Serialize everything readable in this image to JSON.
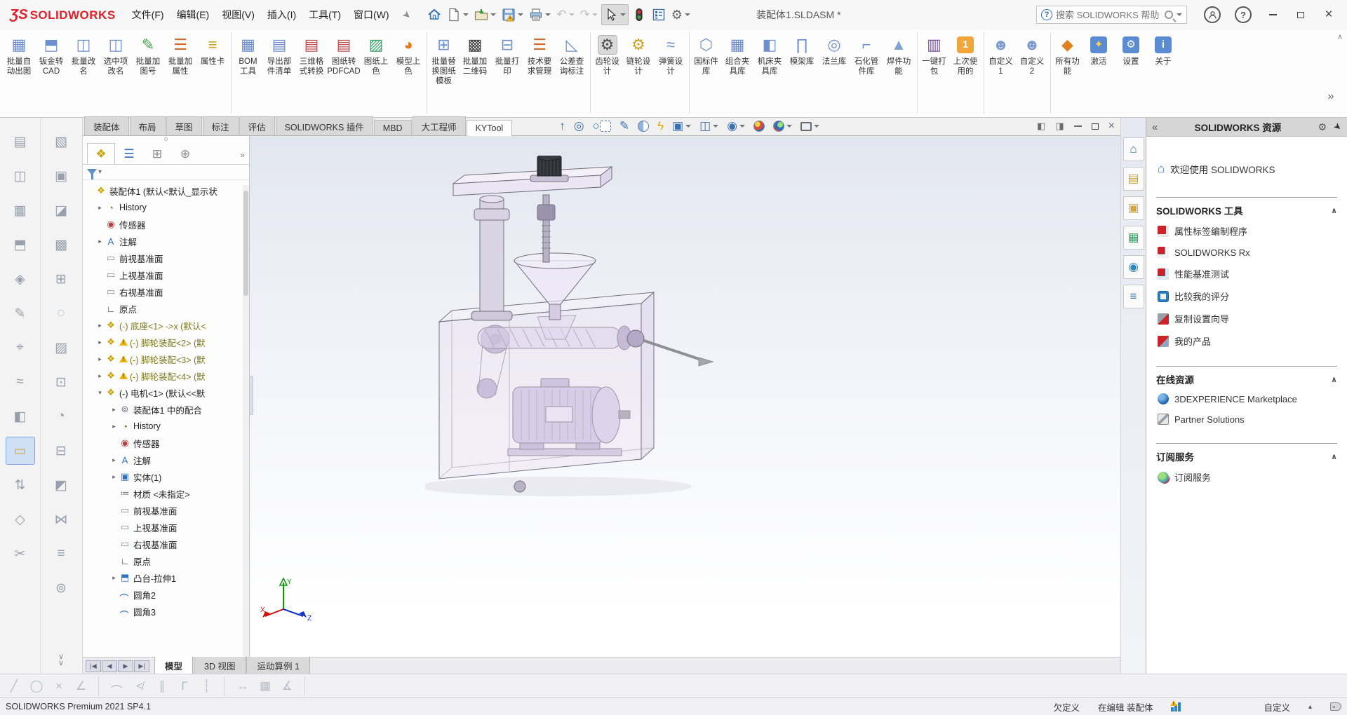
{
  "titlebar": {
    "brand_mark": "ƷS",
    "brand": "SOLIDWORKS",
    "menus": [
      "文件(F)",
      "编辑(E)",
      "视图(V)",
      "插入(I)",
      "工具(T)",
      "窗口(W)"
    ],
    "doc_title": "装配体1.SLDASM *",
    "search": {
      "placeholder": "搜索 SOLIDWORKS 帮助",
      "help_glyph": "?"
    },
    "help_glyph": "?",
    "close_glyph": "×"
  },
  "ribbon": {
    "overflow_glyph": "»",
    "collapse_glyph": "∧",
    "buttons": [
      {
        "l": "批量自\n动出图",
        "g": "▦",
        "c": "#6c8fd0"
      },
      {
        "l": "钣金转\nCAD",
        "g": "⬒",
        "c": "#6c8fd0"
      },
      {
        "l": "批量改\n名",
        "g": "◫",
        "c": "#6c8fd0"
      },
      {
        "l": "选中项\n改名",
        "g": "◫",
        "c": "#6c8fd0"
      },
      {
        "l": "批量加\n图号",
        "g": "✎",
        "c": "#49a04e"
      },
      {
        "l": "批量加\n属性",
        "g": "☰",
        "c": "#d06a2c"
      },
      {
        "l": "属性卡",
        "g": "≡",
        "c": "#c9a227"
      },
      {
        "l": "BOM\n工具",
        "g": "▦",
        "c": "#6c8fd0",
        "cls": "gs"
      },
      {
        "l": "导出部\n件清单",
        "g": "▤",
        "c": "#6c8fd0"
      },
      {
        "l": "三维格\n式转换",
        "g": "▤",
        "c": "#c0504d"
      },
      {
        "l": "图纸转\nPDFCAD",
        "g": "▤",
        "c": "#c0504d"
      },
      {
        "l": "图纸上\n色",
        "g": "▨",
        "c": "#3aa06a"
      },
      {
        "l": "模型上\n色",
        "g": "◕",
        "c": "#e07820"
      },
      {
        "l": "批量替\n换图纸\n模板",
        "g": "⊞",
        "c": "#6c8fd0",
        "cls": "gs"
      },
      {
        "l": "批量加\n二维码",
        "g": "▩",
        "c": "#3c3c3c"
      },
      {
        "l": "批量打\n印",
        "g": "⊟",
        "c": "#6c8fd0"
      },
      {
        "l": "技术要\n求管理",
        "g": "☰",
        "c": "#d06a2c"
      },
      {
        "l": "公差查\n询标注",
        "g": "◺",
        "c": "#6c8fd0"
      },
      {
        "l": "齿轮设\n计",
        "g": "⚙",
        "c": "#4a4a50",
        "cls": "gs pressed"
      },
      {
        "l": "链轮设\n计",
        "g": "⚙",
        "c": "#c9a227"
      },
      {
        "l": "弹簧设\n计",
        "g": "≈",
        "c": "#6c8fd0"
      },
      {
        "l": "国标件\n库",
        "g": "⬡",
        "c": "#6c8fd0",
        "cls": "gs"
      },
      {
        "l": "组合夹\n具库",
        "g": "▦",
        "c": "#6c8fd0"
      },
      {
        "l": "机床夹\n具库",
        "g": "◧",
        "c": "#6c8fd0"
      },
      {
        "l": "模架库",
        "g": "∏",
        "c": "#6c8fd0"
      },
      {
        "l": "法兰库",
        "g": "◎",
        "c": "#6c8fd0"
      },
      {
        "l": "石化管\n件库",
        "g": "⌐",
        "c": "#6c8fd0"
      },
      {
        "l": "焊件功\n能",
        "g": "▲",
        "c": "#7fa3d6"
      },
      {
        "l": "一键打\n包",
        "g": "▥",
        "c": "#7a4fa0",
        "cls": "gs"
      },
      {
        "l": "上次使\n用的",
        "g": "1",
        "c": "#ffffff",
        "bg": "#f0a63a",
        "cls": "chip"
      },
      {
        "l": "自定义\n1",
        "g": "☻",
        "c": "#7d9bd0",
        "cls": "gs"
      },
      {
        "l": "自定义\n2",
        "g": "☻",
        "c": "#7d9bd0"
      },
      {
        "l": "所有功\n能",
        "g": "◆",
        "c": "#e08020",
        "cls": "gs"
      },
      {
        "l": "激活",
        "g": "✦",
        "c": "#ffd24a",
        "bg": "#5b8bd0",
        "cls": "chip"
      },
      {
        "l": "设置",
        "g": "⚙",
        "c": "#ffffff",
        "bg": "#5b8bd0",
        "cls": "chip"
      },
      {
        "l": "关于",
        "g": "i",
        "c": "#ffffff",
        "bg": "#5b8bd0",
        "cls": "chip"
      }
    ]
  },
  "cmdtabs": [
    {
      "l": "装配体"
    },
    {
      "l": "布局"
    },
    {
      "l": "草图"
    },
    {
      "l": "标注"
    },
    {
      "l": "评估"
    },
    {
      "l": "SOLIDWORKS 插件"
    },
    {
      "l": "MBD"
    },
    {
      "l": "大工程师"
    },
    {
      "l": "KYTool",
      "cls": "active"
    }
  ],
  "headsup": [
    {
      "name": "zoom-to-fit",
      "g": "↑",
      "c": "#3a6fae"
    },
    {
      "name": "zoom-to-area",
      "g": "◎",
      "c": "#3a6fae"
    },
    {
      "name": "zoom-area-window",
      "g": "○",
      "c": "#3a6fae",
      "art": "dashbox"
    },
    {
      "name": "previous-view",
      "g": "✎",
      "c": "#3a6fae"
    },
    {
      "name": "section-view",
      "art": "section"
    },
    {
      "name": "dynamic-annotation",
      "g": "ϟ",
      "c": "#e0a400"
    },
    {
      "name": "view-orientation",
      "g": "▣",
      "c": "#3a6fae",
      "dd": true
    },
    {
      "name": "display-style",
      "g": "◫",
      "c": "#3a6fae",
      "dd": true
    },
    {
      "name": "hide-show-items",
      "g": "◉",
      "c": "#3a6fae",
      "dd": true
    },
    {
      "name": "edit-appearance",
      "art": "ball1"
    },
    {
      "name": "apply-scene",
      "art": "ball2",
      "dd": true
    },
    {
      "name": "view-settings",
      "art": "screen",
      "dd": true
    }
  ],
  "winctl": {
    "pane_left": "◧",
    "pane_right": "◨",
    "close": "×"
  },
  "lefttools": {
    "more_glyph": "∨",
    "col1": [
      {
        "g": "▤"
      },
      {
        "g": "◫"
      },
      {
        "g": "▦"
      },
      {
        "g": "⬒"
      },
      {
        "g": "◈"
      },
      {
        "g": "✎"
      },
      {
        "g": "⌖"
      },
      {
        "g": "≈"
      },
      {
        "g": "◧"
      },
      {
        "g": "▭",
        "c": "#d0a540",
        "cls": "active"
      },
      {
        "g": "⇅"
      },
      {
        "g": "◇"
      },
      {
        "g": "✂"
      }
    ],
    "col2": [
      {
        "g": "▧"
      },
      {
        "g": "▣"
      },
      {
        "g": "◪"
      },
      {
        "g": "▩"
      },
      {
        "g": "⊞"
      },
      {
        "g": "◌"
      },
      {
        "g": "▨"
      },
      {
        "g": "⊡"
      },
      {
        "g": "◔"
      },
      {
        "g": "⊟"
      },
      {
        "g": "◩"
      },
      {
        "g": "⋈"
      },
      {
        "g": "≡"
      },
      {
        "g": "⊚"
      }
    ]
  },
  "fm": {
    "filter_glyph": "▾",
    "more_glyph": "»",
    "tabs": [
      {
        "ic": "fm-assembly",
        "g": "❖",
        "c": "#c8a200",
        "cls": "active"
      },
      {
        "ic": "fm-property-manager",
        "g": "☰",
        "c": "#2e6fbe"
      },
      {
        "ic": "fm-configurations",
        "g": "⊞",
        "c": "#8a8a8a"
      },
      {
        "ic": "fm-dimxpert",
        "g": "⊕",
        "c": "#8a8a8a"
      }
    ],
    "items": [
      {
        "ind": 0,
        "a": "",
        "g": "❖",
        "c": "#c8a200",
        "l": "装配体1 (默认<默认_显示状"
      },
      {
        "ind": 1,
        "a": "▸",
        "g": "◔",
        "c": "#8a6d3b",
        "l": "History"
      },
      {
        "ind": 1,
        "a": "",
        "g": "◉",
        "c": "#b34040",
        "l": "传感器"
      },
      {
        "ind": 1,
        "a": "▸",
        "g": "A",
        "c": "#2e6fbe",
        "l": "注解"
      },
      {
        "ind": 1,
        "a": "",
        "g": "▭",
        "c": "#7d93ad",
        "l": "前视基准面"
      },
      {
        "ind": 1,
        "a": "",
        "g": "▭",
        "c": "#7d93ad",
        "l": "上视基准面"
      },
      {
        "ind": 1,
        "a": "",
        "g": "▭",
        "c": "#7d93ad",
        "l": "右视基准面"
      },
      {
        "ind": 1,
        "a": "",
        "g": "∟",
        "c": "#444444",
        "l": "原点"
      },
      {
        "ind": 1,
        "a": "▸",
        "g": "❖",
        "c": "#c8a200",
        "l": "(-) 底座<1> ->x (默认<",
        "cls": "olive"
      },
      {
        "ind": 1,
        "a": "▸",
        "g": "❖",
        "c": "#c8a200",
        "warn": true,
        "l": "(-) 脚轮装配<2> (默",
        "cls": "olive"
      },
      {
        "ind": 1,
        "a": "▸",
        "g": "❖",
        "c": "#c8a200",
        "warn": true,
        "l": "(-) 脚轮装配<3> (默",
        "cls": "olive"
      },
      {
        "ind": 1,
        "a": "▸",
        "g": "❖",
        "c": "#c8a200",
        "warn": true,
        "l": "(-) 脚轮装配<4> (默",
        "cls": "olive"
      },
      {
        "ind": 1,
        "a": "▾",
        "g": "❖",
        "c": "#c8a200",
        "l": "(-) 电机<1> (默认<<默"
      },
      {
        "ind": 2,
        "a": "▸",
        "g": "⊚",
        "c": "#6b7b8c",
        "l": "装配体1 中的配合"
      },
      {
        "ind": 2,
        "a": "▸",
        "g": "◔",
        "c": "#8a6d3b",
        "l": "History"
      },
      {
        "ind": 2,
        "a": "",
        "g": "◉",
        "c": "#b34040",
        "l": "传感器"
      },
      {
        "ind": 2,
        "a": "▸",
        "g": "A",
        "c": "#2e6fbe",
        "l": "注解"
      },
      {
        "ind": 2,
        "a": "▸",
        "g": "▣",
        "c": "#2e6fbe",
        "l": "实体(1)"
      },
      {
        "ind": 2,
        "a": "",
        "g": "≔",
        "c": "#777777",
        "l": "材质 <未指定>"
      },
      {
        "ind": 2,
        "a": "",
        "g": "▭",
        "c": "#7d93ad",
        "l": "前视基准面"
      },
      {
        "ind": 2,
        "a": "",
        "g": "▭",
        "c": "#7d93ad",
        "l": "上视基准面"
      },
      {
        "ind": 2,
        "a": "",
        "g": "▭",
        "c": "#7d93ad",
        "l": "右视基准面"
      },
      {
        "ind": 2,
        "a": "",
        "g": "∟",
        "c": "#444444",
        "l": "原点"
      },
      {
        "ind": 2,
        "a": "▸",
        "g": "⬒",
        "c": "#2e6fbe",
        "l": "凸台-拉伸1"
      },
      {
        "ind": 2,
        "a": "",
        "g": "(",
        "c": "#2e6fbe",
        "icls": "rot",
        "l": "圆角2"
      },
      {
        "ind": 2,
        "a": "",
        "g": "(",
        "c": "#2e6fbe",
        "icls": "rot",
        "l": "圆角3"
      }
    ]
  },
  "panel_tabs": [
    {
      "name": "solidworks-resources",
      "g": "⌂",
      "c": "#3a6fa5"
    },
    {
      "name": "design-library",
      "g": "▤",
      "c": "#c9a227"
    },
    {
      "name": "file-explorer",
      "g": "▣",
      "c": "#d8a73a"
    },
    {
      "name": "view-palette",
      "g": "▦",
      "c": "#3aa06a"
    },
    {
      "name": "appearances-scenes",
      "g": "◉",
      "c": "#2e86be"
    },
    {
      "name": "custom-properties",
      "g": "≡",
      "c": "#3a6fa5"
    }
  ],
  "taskpane": {
    "collapse_glyph": "«",
    "title": "SOLIDWORKS 资源",
    "welcome": "欢迎使用  SOLIDWORKS",
    "home_glyph": "⌂",
    "gear_glyph": "⚙",
    "pin_glyph": "➤",
    "collapse_section_glyph": "∧",
    "sections": [
      {
        "title": "SOLIDWORKS 工具",
        "items": [
          {
            "l": "属性标签编制程序",
            "ic": "ic-swtab"
          },
          {
            "l": "SOLIDWORKS Rx",
            "ic": "ic-swrx"
          },
          {
            "l": "性能基准测试",
            "ic": "ic-swbench"
          },
          {
            "l": "比较我的评分",
            "ic": "ic-compare"
          },
          {
            "l": "复制设置向导",
            "ic": "ic-copy"
          },
          {
            "l": "我的产品",
            "ic": "ic-products"
          }
        ]
      },
      {
        "title": "在线资源",
        "items": [
          {
            "l": "3DEXPERIENCE Marketplace",
            "ic": "ic-3dx"
          },
          {
            "l": "Partner Solutions",
            "ic": "ic-partner"
          }
        ]
      },
      {
        "title": "订阅服务",
        "items": [
          {
            "l": "订阅服务",
            "ic": "ic-subs"
          }
        ]
      }
    ]
  },
  "modeltabs": {
    "nav": [
      "|◀",
      "◀",
      "▶",
      "▶|"
    ],
    "tabs": [
      {
        "l": "模型",
        "cls": "active"
      },
      {
        "l": "3D 视图"
      },
      {
        "l": "运动算例 1"
      }
    ]
  },
  "sketchbar": [
    {
      "g": "╱"
    },
    {
      "g": "◯"
    },
    {
      "g": "×"
    },
    {
      "g": "∠",
      "cls": "sep"
    },
    {
      "g": "(",
      "icls": "rot"
    },
    {
      "g": "≮"
    },
    {
      "g": "∥"
    },
    {
      "g": "Γ"
    },
    {
      "g": "┆",
      "cls": "sep"
    },
    {
      "g": "↔"
    },
    {
      "g": "▦"
    },
    {
      "g": "∡",
      "cls": "sep"
    }
  ],
  "statusbar": {
    "left": "SOLIDWORKS Premium 2021 SP4.1",
    "underdefined": "欠定义",
    "editing": "在编辑 装配体",
    "custom": "自定义",
    "custom_caret": "▴"
  },
  "viewport": {
    "triad": {
      "x": "X",
      "y": "Y",
      "z": "Z"
    }
  }
}
